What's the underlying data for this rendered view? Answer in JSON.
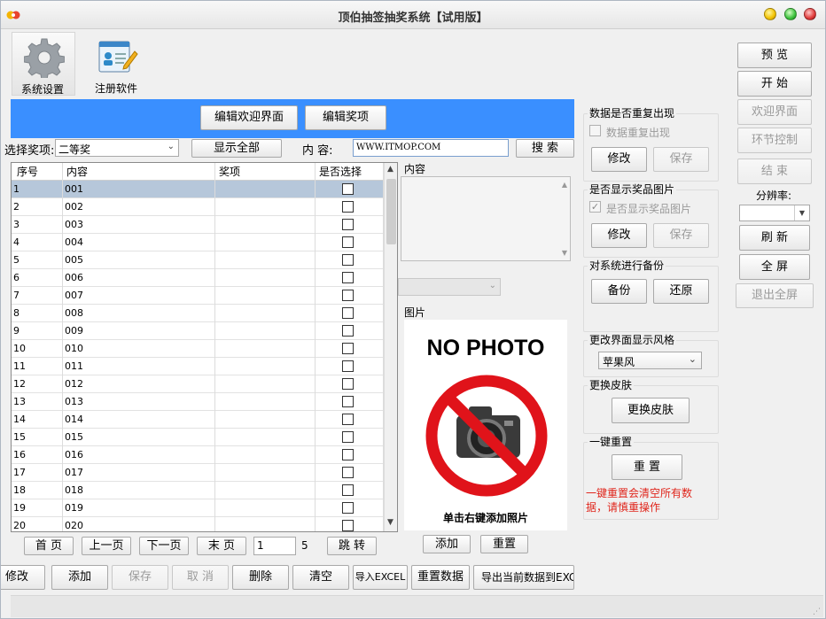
{
  "window": {
    "title": "顶伯抽签抽奖系统【试用版】"
  },
  "toolbar": {
    "settings_label": "系统设置",
    "settings_icon": "gear-icon",
    "register_label": "注册软件",
    "register_icon": "register-card-icon"
  },
  "banner": {
    "edit_welcome": "编辑欢迎界面",
    "edit_prize": "编辑奖项"
  },
  "filter": {
    "prize_label": "选择奖项:",
    "prize_value": "二等奖",
    "show_all": "显示全部",
    "content_label": "内  容:",
    "content_value": "WWW.ITMOP.COM",
    "search": "搜  索"
  },
  "table": {
    "columns": [
      "序号",
      "内容",
      "奖项",
      "是否选择"
    ],
    "rows": [
      {
        "no": "1",
        "content": "001"
      },
      {
        "no": "2",
        "content": "002"
      },
      {
        "no": "3",
        "content": "003"
      },
      {
        "no": "4",
        "content": "004"
      },
      {
        "no": "5",
        "content": "005"
      },
      {
        "no": "6",
        "content": "006"
      },
      {
        "no": "7",
        "content": "007"
      },
      {
        "no": "8",
        "content": "008"
      },
      {
        "no": "9",
        "content": "009"
      },
      {
        "no": "10",
        "content": "010"
      },
      {
        "no": "11",
        "content": "011"
      },
      {
        "no": "12",
        "content": "012"
      },
      {
        "no": "13",
        "content": "013"
      },
      {
        "no": "14",
        "content": "014"
      },
      {
        "no": "15",
        "content": "015"
      },
      {
        "no": "16",
        "content": "016"
      },
      {
        "no": "17",
        "content": "017"
      },
      {
        "no": "18",
        "content": "018"
      },
      {
        "no": "19",
        "content": "019"
      },
      {
        "no": "20",
        "content": "020"
      }
    ]
  },
  "detail": {
    "content_label": "内容",
    "picture_label": "图片",
    "no_photo": "NO PHOTO",
    "photo_hint": "单击右键添加照片",
    "add": "添加",
    "reset": "重置"
  },
  "pager": {
    "first": "首  页",
    "prev": "上一页",
    "next": "下一页",
    "last": "末  页",
    "page_value": "1",
    "total_pages": "5",
    "jump": "跳  转"
  },
  "actions": {
    "modify": "修改",
    "add": "添加",
    "save": "保存",
    "cancel": "取  消",
    "delete": "删除",
    "clear": "清空",
    "import": "导入EXCEL",
    "reset_data": "重置数据",
    "export": "导出当前数据到EXCEL"
  },
  "settings": {
    "dup_title": "数据是否重复出现",
    "dup_check": "数据重复出现",
    "dup_modify": "修改",
    "dup_save": "保存",
    "img_title": "是否显示奖品图片",
    "img_check": "是否显示奖品图片",
    "img_modify": "修改",
    "img_save": "保存",
    "backup_title": "对系统进行备份",
    "backup": "备份",
    "restore": "还原",
    "style_title": "更改界面显示风格",
    "style_value": "苹果风",
    "skin_title": "更换皮肤",
    "skin_button": "更换皮肤",
    "reset_title": "一键重置",
    "reset_button": "重  置",
    "reset_warning": "一键重置会清空所有数据，请慎重操作"
  },
  "side": {
    "preview": "预  览",
    "start": "开  始",
    "welcome": "欢迎界面",
    "stage": "环节控制",
    "end": "结  束",
    "resolution_label": "分辨率:",
    "refresh": "刷  新",
    "fullscreen": "全  屏",
    "exit_fullscreen": "退出全屏"
  },
  "colors": {
    "banner_blue": "#3a8fff",
    "warning_red": "#e0261c",
    "selected_row": "#b6c7da"
  }
}
